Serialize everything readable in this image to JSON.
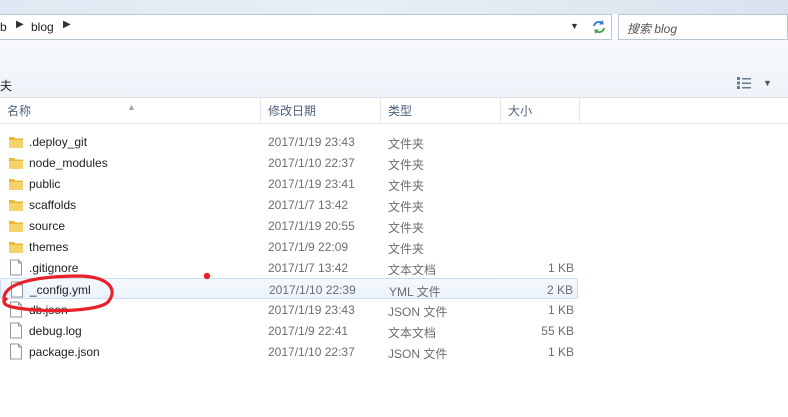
{
  "addressbar": {
    "crumbs": [
      "b",
      "blog"
    ]
  },
  "search": {
    "placeholder": "搜索 blog"
  },
  "toolbar": {
    "fragment": "夫"
  },
  "columns": {
    "name": "名称",
    "date": "修改日期",
    "type": "类型",
    "size": "大小"
  },
  "files": [
    {
      "name": ".deploy_git",
      "date": "2017/1/19 23:43",
      "type": "文件夹",
      "size": "",
      "kind": "folder"
    },
    {
      "name": "node_modules",
      "date": "2017/1/10 22:37",
      "type": "文件夹",
      "size": "",
      "kind": "folder"
    },
    {
      "name": "public",
      "date": "2017/1/19 23:41",
      "type": "文件夹",
      "size": "",
      "kind": "folder"
    },
    {
      "name": "scaffolds",
      "date": "2017/1/7 13:42",
      "type": "文件夹",
      "size": "",
      "kind": "folder"
    },
    {
      "name": "source",
      "date": "2017/1/19 20:55",
      "type": "文件夹",
      "size": "",
      "kind": "folder"
    },
    {
      "name": "themes",
      "date": "2017/1/9 22:09",
      "type": "文件夹",
      "size": "",
      "kind": "folder"
    },
    {
      "name": ".gitignore",
      "date": "2017/1/7 13:42",
      "type": "文本文档",
      "size": "1 KB",
      "kind": "file"
    },
    {
      "name": "_config.yml",
      "date": "2017/1/10 22:39",
      "type": "YML 文件",
      "size": "2 KB",
      "kind": "file",
      "selected": true
    },
    {
      "name": "db.json",
      "date": "2017/1/19 23:43",
      "type": "JSON 文件",
      "size": "1 KB",
      "kind": "file"
    },
    {
      "name": "debug.log",
      "date": "2017/1/9 22:41",
      "type": "文本文档",
      "size": "55 KB",
      "kind": "file"
    },
    {
      "name": "package.json",
      "date": "2017/1/10 22:37",
      "type": "JSON 文件",
      "size": "1 KB",
      "kind": "file"
    }
  ],
  "colors": {
    "annotation": "#e8202a",
    "selection": "#c9dcf0",
    "folder": "#e8b73a"
  }
}
